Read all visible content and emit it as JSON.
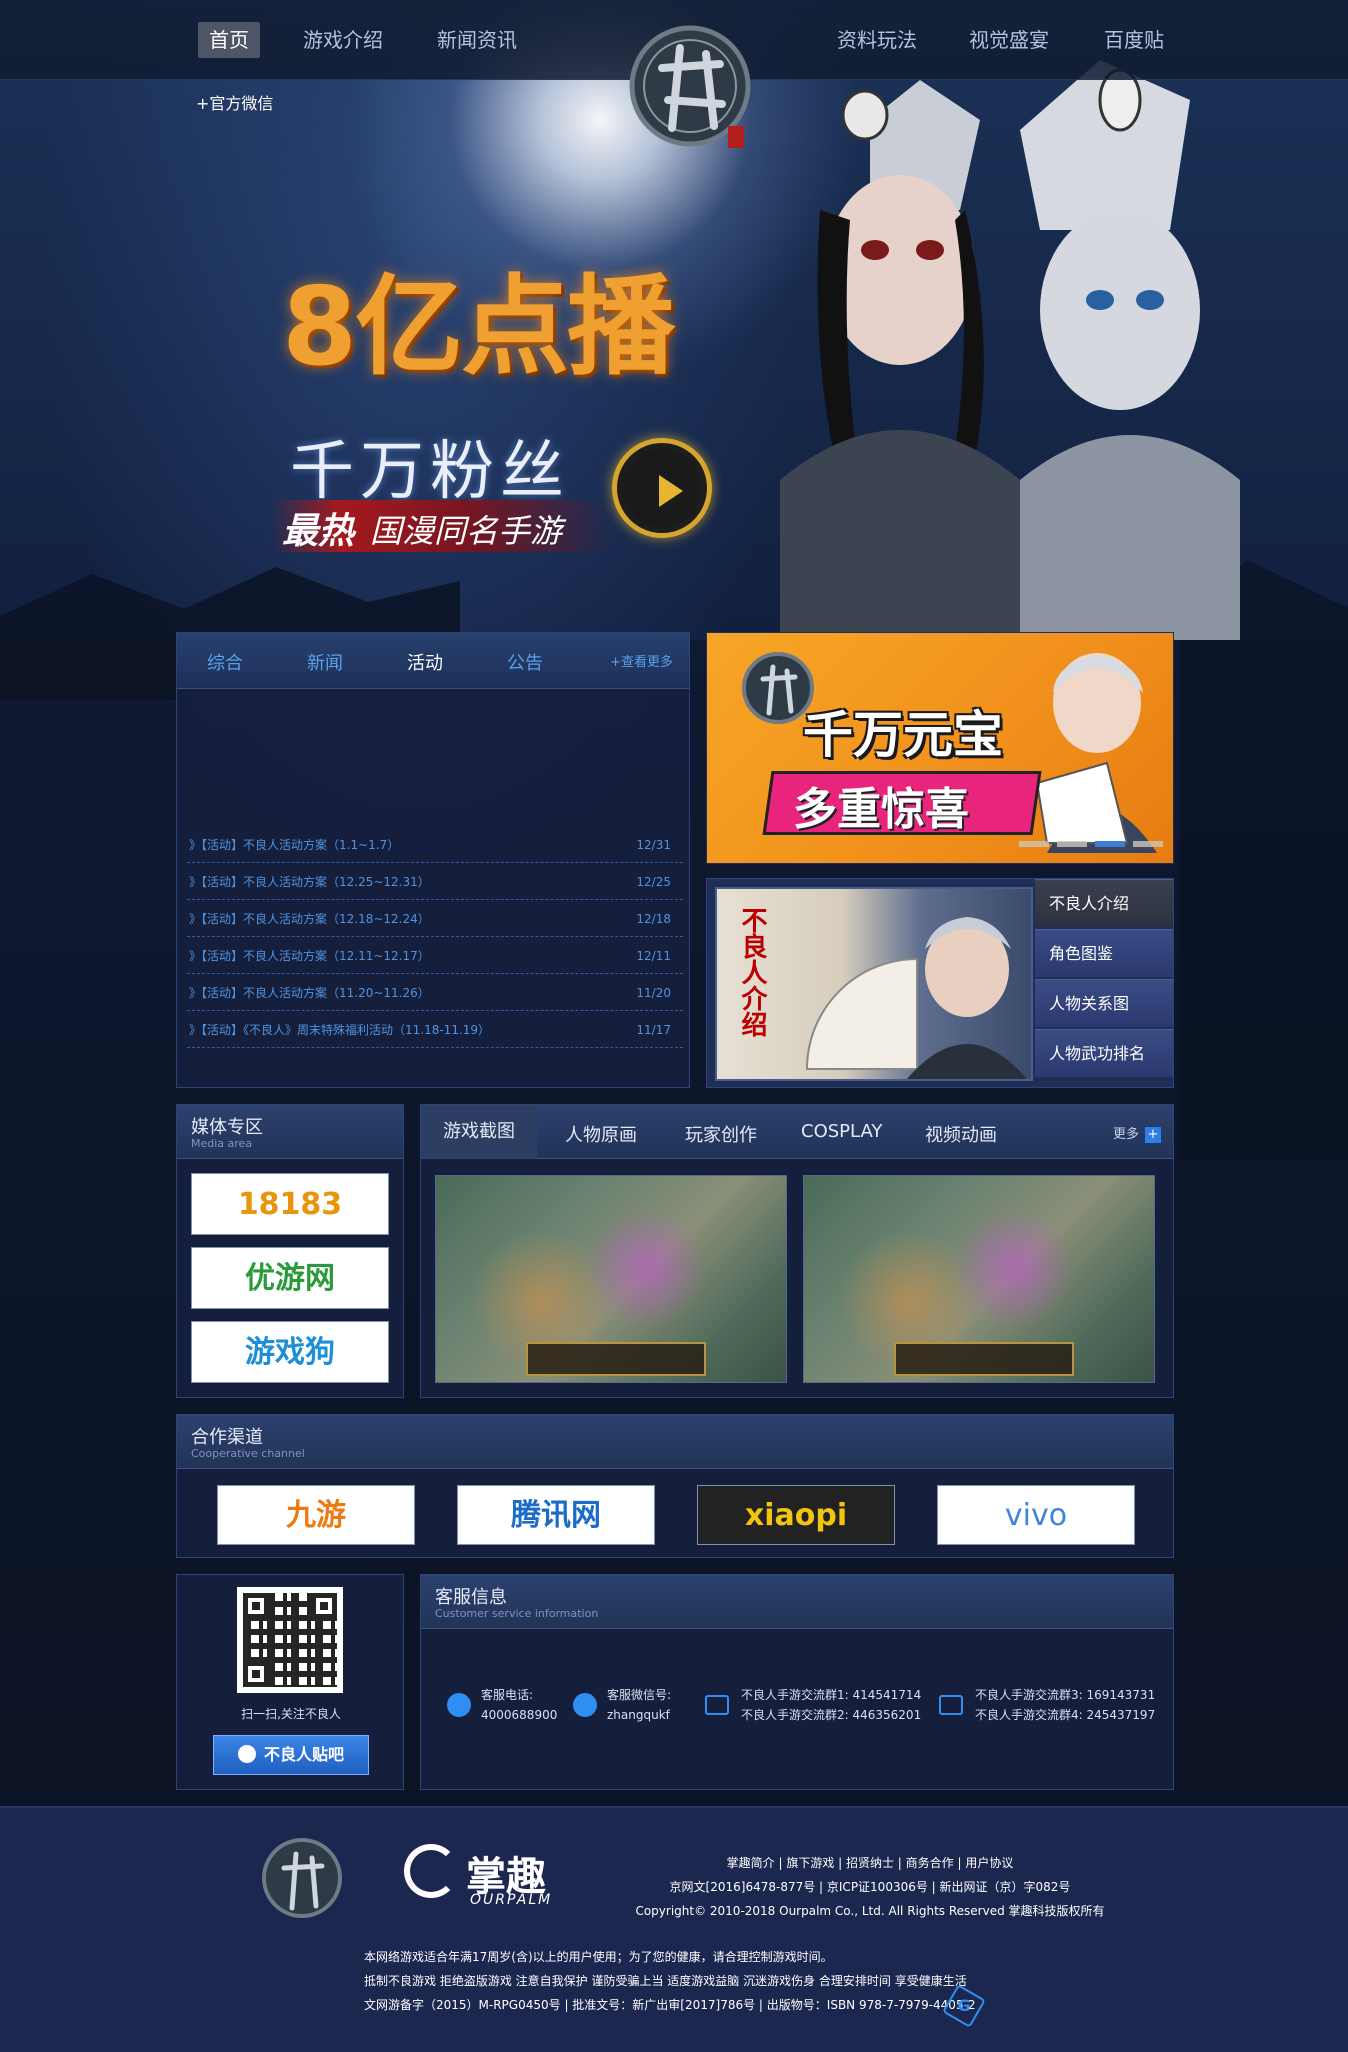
{
  "nav": {
    "left": [
      "首页",
      "游戏介绍",
      "新闻资讯"
    ],
    "right": [
      "资料玩法",
      "视觉盛宴",
      "百度贴"
    ],
    "wechat": "+官方微信"
  },
  "hero": {
    "headline": "8亿点播",
    "line2": "千万粉丝",
    "hot": "最热",
    "line3": "国漫同名手游"
  },
  "news": {
    "tabs": [
      "综合",
      "新闻",
      "活动",
      "公告"
    ],
    "active_tab": "活动",
    "more": "+查看更多",
    "items": [
      {
        "title": "》【活动】不良人活动方案（1.1~1.7）",
        "date": "12/31"
      },
      {
        "title": "》【活动】不良人活动方案（12.25~12.31）",
        "date": "12/25"
      },
      {
        "title": "》【活动】不良人活动方案（12.18~12.24）",
        "date": "12/18"
      },
      {
        "title": "》【活动】不良人活动方案（12.11~12.17）",
        "date": "12/11"
      },
      {
        "title": "》【活动】不良人活动方案（11.20~11.26）",
        "date": "11/20"
      },
      {
        "title": "》【活动】《不良人》周末特殊福利活动（11.18-11.19）",
        "date": "11/17"
      }
    ]
  },
  "promo": {
    "banner_title": "千万元宝",
    "banner_sub": "多重惊喜",
    "card_vertical": "不良人介绍",
    "side_links": [
      "不良人介绍",
      "角色图鉴",
      "人物关系图",
      "人物武功排名"
    ]
  },
  "media": {
    "title": "媒体专区",
    "subtitle": "Media area",
    "logos": [
      "18183",
      "优游网",
      "游戏狗"
    ]
  },
  "gallery": {
    "tabs": [
      "游戏截图",
      "人物原画",
      "玩家创作",
      "COSPLAY",
      "视频动画"
    ],
    "more": "更多"
  },
  "partners": {
    "title": "合作渠道",
    "subtitle": "Cooperative channel",
    "logos": [
      "九游",
      "腾讯网",
      "xiaopi",
      "vivo"
    ]
  },
  "follow": {
    "caption": "扫一扫,关注不良人",
    "button": "不良人贴吧"
  },
  "service": {
    "title": "客服信息",
    "subtitle": "Customer service information",
    "phone_label": "客服电话:",
    "phone": "4000688900",
    "wechat_label": "客服微信号:",
    "wechat": "zhangqukf",
    "group1": "不良人手游交流群1:  414541714",
    "group2": "不良人手游交流群2:  446356201",
    "group3": "不良人手游交流群3:  169143731",
    "group4": "不良人手游交流群4:  245437197"
  },
  "footer": {
    "brand_cn": "掌趣",
    "brand_en": "OURPALM",
    "links": "掌趣简介 | 旗下游戏 | 招贤纳士 | 商务合作 | 用户协议",
    "licenses": "京网文[2016]6478-877号 | 京ICP证100306号 | 新出网证（京）字082号",
    "copyright": "Copyright© 2010-2018 Ourpalm Co., Ltd. All Rights Reserved 掌趣科技版权所有",
    "age_notice": "本网络游戏适合年满17周岁(含)以上的用户使用；为了您的健康，请合理控制游戏时间。",
    "health": "抵制不良游戏 拒绝盗版游戏 注意自我保护 谨防受骗上当 适度游戏益脑 沉迷游戏伤身 合理安排时间 享受健康生活",
    "record": "文网游备字（2015）M-RPG0450号 | 批准文号：新广出审[2017]786号 | 出版物号：ISBN 978-7-7979-4405-2"
  }
}
